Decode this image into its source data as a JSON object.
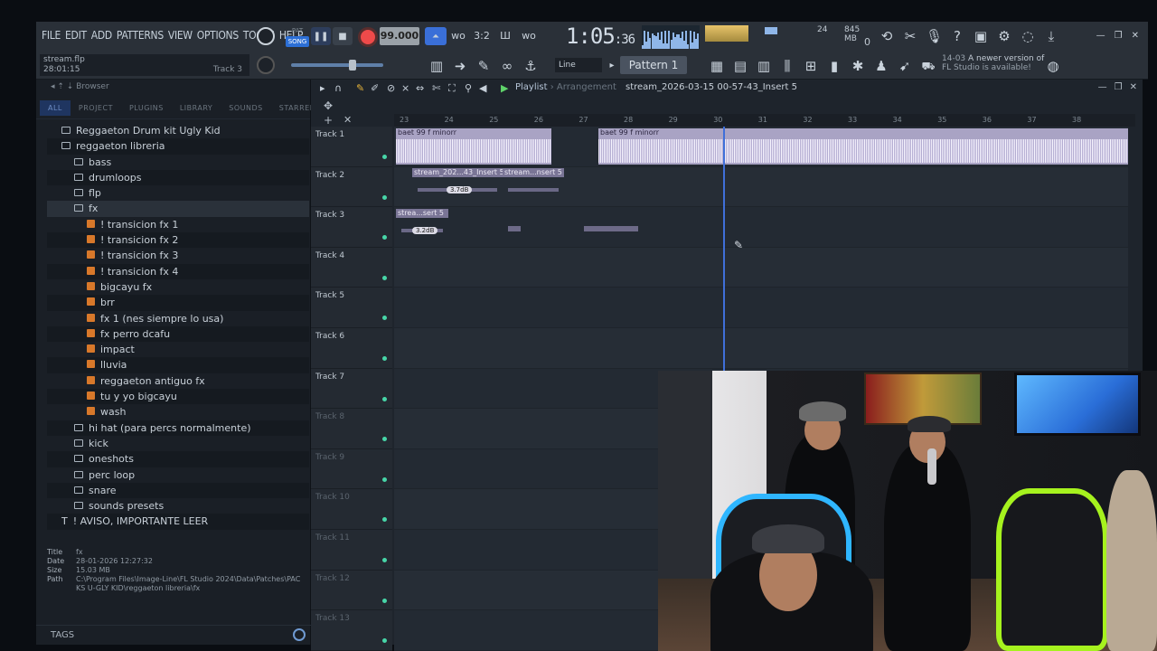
{
  "menu": [
    "FILE",
    "EDIT",
    "ADD",
    "PATTERNS",
    "VIEW",
    "OPTIONS",
    "TOOLS",
    "HELP"
  ],
  "hint": {
    "file": "stream.flp",
    "time": "28:01:15",
    "track": "Track 3"
  },
  "transport": {
    "mode_top": "PAT",
    "mode_bottom": "SONG",
    "tempo": "99.000",
    "time_main": "1:05",
    "time_sub": ":36",
    "cpu_left": "24",
    "memory": "845 MB",
    "mem_sub": "0"
  },
  "toolbar": {
    "snap": "Line",
    "pattern": "Pattern 1"
  },
  "news": {
    "date": "14-03",
    "line1": "A newer version of",
    "line2": "FL Studio is available!"
  },
  "browser": {
    "title": "Browser",
    "tabs": [
      "ALL",
      "PROJECT",
      "PLUGINS",
      "LIBRARY",
      "SOUNDS",
      "STARRED"
    ],
    "items": [
      {
        "label": "Reggaeton Drum kit Ugly Kid",
        "type": "folder",
        "indent": 1
      },
      {
        "label": "reggaeton libreria",
        "type": "folder",
        "indent": 1
      },
      {
        "label": "bass",
        "type": "folder",
        "indent": 2
      },
      {
        "label": "drumloops",
        "type": "folder",
        "indent": 2
      },
      {
        "label": "flp",
        "type": "folder",
        "indent": 2
      },
      {
        "label": "fx",
        "type": "folder",
        "indent": 2
      },
      {
        "label": "! transicion fx 1",
        "type": "file",
        "indent": 3
      },
      {
        "label": "! transicion fx 2",
        "type": "file",
        "indent": 3
      },
      {
        "label": "! transicion fx 3",
        "type": "file",
        "indent": 3
      },
      {
        "label": "! transicion fx 4",
        "type": "file",
        "indent": 3
      },
      {
        "label": "bigcayu fx",
        "type": "file",
        "indent": 3
      },
      {
        "label": "brr",
        "type": "file",
        "indent": 3
      },
      {
        "label": "fx 1 (nes siempre lo usa)",
        "type": "file",
        "indent": 3
      },
      {
        "label": "fx perro dcafu",
        "type": "file",
        "indent": 3
      },
      {
        "label": "impact",
        "type": "file",
        "indent": 3
      },
      {
        "label": "lluvia",
        "type": "file",
        "indent": 3
      },
      {
        "label": "reggaeton antiguo fx",
        "type": "file",
        "indent": 3
      },
      {
        "label": "tu y yo bigcayu",
        "type": "file",
        "indent": 3
      },
      {
        "label": "wash",
        "type": "file",
        "indent": 3
      },
      {
        "label": "hi hat (para percs normalmente)",
        "type": "folder",
        "indent": 2
      },
      {
        "label": "kick",
        "type": "folder",
        "indent": 2
      },
      {
        "label": "oneshots",
        "type": "folder",
        "indent": 2
      },
      {
        "label": "perc loop",
        "type": "folder",
        "indent": 2
      },
      {
        "label": "snare",
        "type": "folder",
        "indent": 2
      },
      {
        "label": "sounds presets",
        "type": "folder",
        "indent": 2
      },
      {
        "label": "! AVISO, IMPORTANTE LEER",
        "type": "text",
        "indent": 1
      }
    ],
    "info": {
      "title_k": "Title",
      "title_v": "fx",
      "date_k": "Date",
      "date_v": "28-01-2026 12:27:32",
      "size_k": "Size",
      "size_v": "15.03 MB",
      "path_k": "Path",
      "path_v": "C:\\Program Files\\Image-Line\\FL Studio 2024\\Data\\Patches\\PACKS U-GLY KID\\reggaeton libreria\\fx"
    },
    "tags_label": "TAGS"
  },
  "playlist": {
    "title": "Playlist",
    "sep": "›",
    "subtitle": "Arrangement",
    "file": "stream_2026-03-15 00-57-43_Insert 5",
    "ruler": [
      "23",
      "24",
      "25",
      "26",
      "27",
      "28",
      "29",
      "30",
      "31",
      "32",
      "33",
      "34",
      "35",
      "36",
      "37",
      "38"
    ],
    "tracks": [
      "Track 1",
      "Track 2",
      "Track 3",
      "Track 4",
      "Track 5",
      "Track 6",
      "Track 7",
      "Track 8",
      "Track 9",
      "Track 10",
      "Track 11",
      "Track 12",
      "Track 13"
    ],
    "clips": {
      "t1a": "baet 99 f minorr",
      "t1b": "baet 99 f minorr",
      "t2a": "stream_202...43_Insert 5",
      "t2b": "stream...nsert 5",
      "t2db": "3.7dB",
      "t3a": "strea...sert 5",
      "t3db": "3.2dB"
    }
  }
}
